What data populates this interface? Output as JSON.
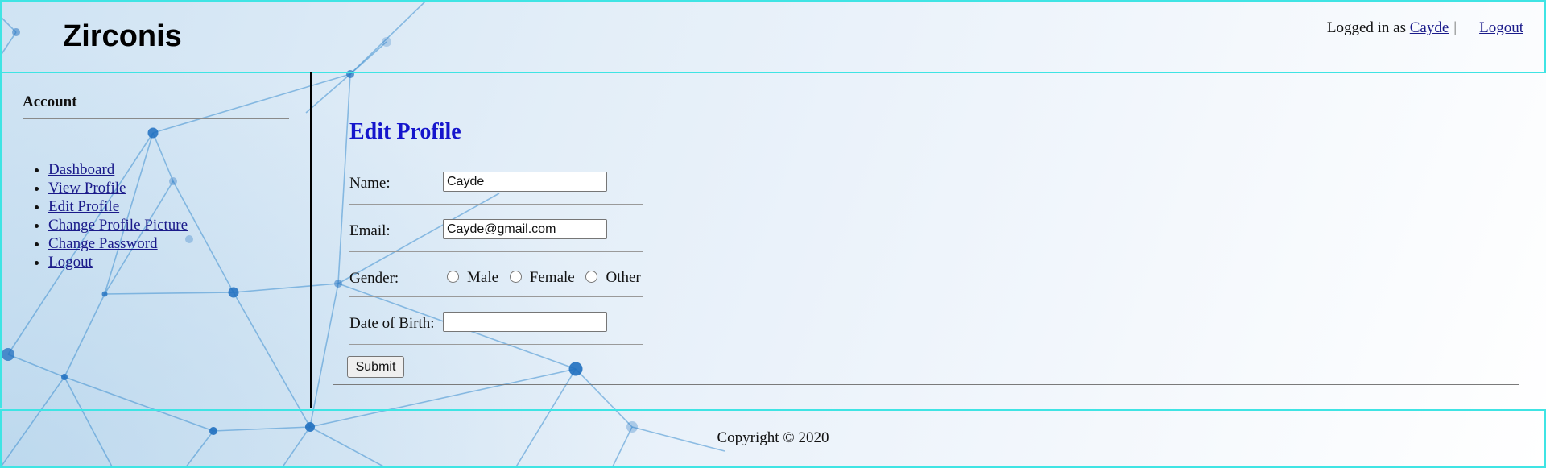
{
  "header": {
    "site_title": "Zirconis",
    "logged_in_prefix": "Logged in as",
    "username": "Cayde",
    "separator": "|",
    "logout_label": "Logout"
  },
  "sidebar": {
    "heading": "Account",
    "items": [
      {
        "label": "Dashboard"
      },
      {
        "label": "View Profile"
      },
      {
        "label": "Edit Profile"
      },
      {
        "label": "Change Profile Picture"
      },
      {
        "label": "Change Password"
      },
      {
        "label": "Logout"
      }
    ]
  },
  "form": {
    "legend": "Edit Profile",
    "name_label": "Name:",
    "name_value": "Cayde",
    "email_label": "Email:",
    "email_value": "Cayde@gmail.com",
    "gender_label": "Gender:",
    "gender_options": [
      "Male",
      "Female",
      "Other"
    ],
    "dob_label": "Date of Birth:",
    "dob_value": "",
    "submit_label": "Submit"
  },
  "footer": {
    "copyright": "Copyright © 2020"
  },
  "colors": {
    "frame_border": "#3fe4e4",
    "legend_color": "#1515cc",
    "link_color": "#1a1a8a"
  }
}
